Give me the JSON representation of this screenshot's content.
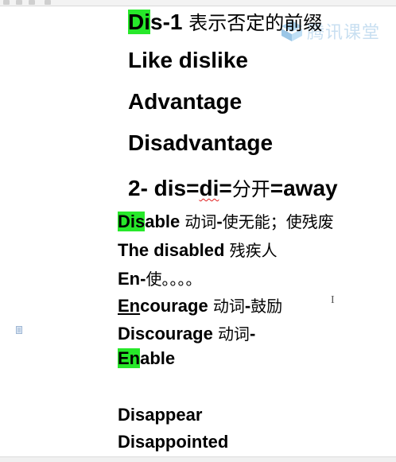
{
  "lines": {
    "l1": {
      "a": "Di",
      "b": "s-1",
      "zh": "表示否定的前缀"
    },
    "l2": {
      "text": "Like dislike"
    },
    "l3": {
      "text": "Advantage"
    },
    "l4": {
      "text": "Disadvantage"
    },
    "l5": {
      "a": "2- dis=",
      "b": "di",
      "c": "=",
      "zh": "分开",
      "d": "=away"
    },
    "l6": {
      "a": "Dis",
      "b": "able ",
      "zh": "动词",
      "c": "-",
      "zh2": "使无能；使残废"
    },
    "l7": {
      "a": "The disabled ",
      "zh": "残疾人"
    },
    "l8": {
      "a": "En-",
      "zh": "使。。。。"
    },
    "l9": {
      "a": "En",
      "b": "courage ",
      "zh": "动词",
      "c": "-",
      "zh2": "鼓励"
    },
    "l10": {
      "a": "Discourage ",
      "zh": "动词",
      "c": "-"
    },
    "l11": {
      "a": "En",
      "b": "able"
    },
    "l12": {
      "text": "Disappear"
    },
    "l13": {
      "text": "Disappointed"
    }
  },
  "watermark": {
    "text": "腾讯课堂",
    "icon": "tencent-classroom-logo-icon"
  },
  "cursor": {
    "glyph": "I",
    "icon": "text-cursor-icon"
  },
  "colors": {
    "highlight": "#27e82a",
    "watermark": "#9cc6e6"
  }
}
